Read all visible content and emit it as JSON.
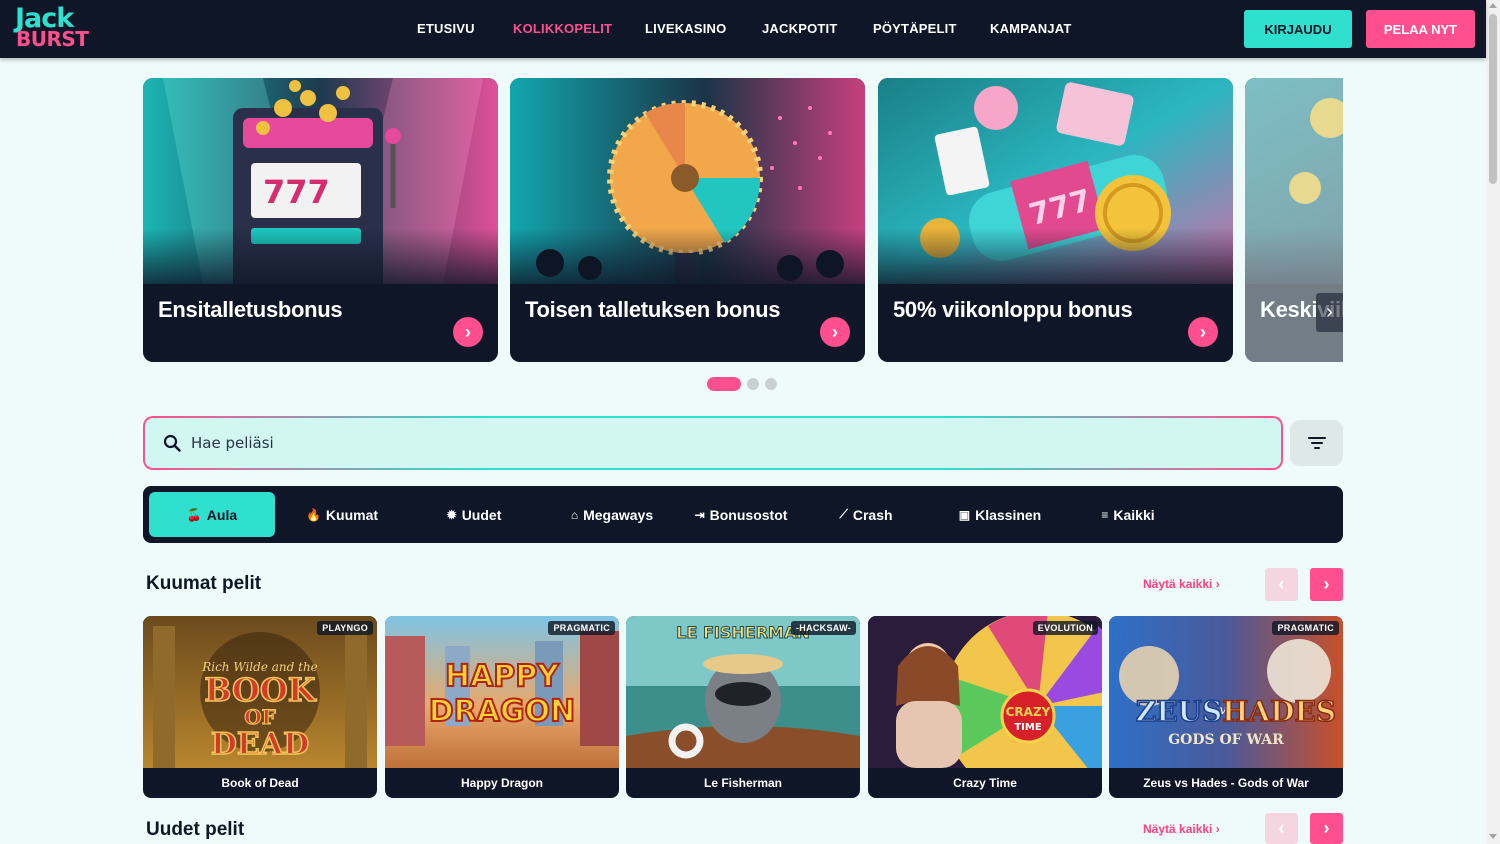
{
  "brand": {
    "logo_top": "Jack",
    "logo_bottom": "BURST"
  },
  "nav": {
    "items": [
      "ETUSIVU",
      "KOLIKKOPELIT",
      "LIVEKASINO",
      "JACKPOTIT",
      "PÖYTÄPELIT",
      "KAMPANJAT"
    ],
    "active": "KOLIKKOPELIT",
    "login_label": "KIRJAUDU",
    "play_label": "PELAA NYT"
  },
  "promos": [
    {
      "title": "Ensitalletusbonus",
      "icon": "chevron-right-icon"
    },
    {
      "title": "Toisen talletuksen bonus",
      "icon": "chevron-right-icon"
    },
    {
      "title": "50% viikonloppu bonus",
      "icon": "chevron-right-icon"
    },
    {
      "title": "Keskiviikon",
      "icon": "chevron-right-icon"
    }
  ],
  "carousel": {
    "pages": 3,
    "active_page": 1
  },
  "search": {
    "placeholder": "Hae peliäsi",
    "value": ""
  },
  "categories": [
    {
      "label": "Aula",
      "icon": "cherries-icon"
    },
    {
      "label": "Kuumat",
      "icon": "flame-icon"
    },
    {
      "label": "Uudet",
      "icon": "sparkle-icon"
    },
    {
      "label": "Megaways",
      "icon": "temple-icon"
    },
    {
      "label": "Bonusostot",
      "icon": "bonus-buy-icon"
    },
    {
      "label": "Crash",
      "icon": "trend-line-icon"
    },
    {
      "label": "Klassinen",
      "icon": "slot-machine-icon"
    },
    {
      "label": "Kaikki",
      "icon": "list-icon"
    }
  ],
  "sections": [
    {
      "title": "Kuumat pelit",
      "show_all": "Näytä kaikki",
      "games": [
        {
          "name": "Book of Dead",
          "provider": "PLAYNGO"
        },
        {
          "name": "Happy Dragon",
          "provider": "PRAGMATIC"
        },
        {
          "name": "Le Fisherman",
          "provider": "-HACKSAW-"
        },
        {
          "name": "Crazy Time",
          "provider": "EVOLUTION"
        },
        {
          "name": "Zeus vs Hades - Gods of War",
          "provider": "PRAGMATIC"
        }
      ]
    },
    {
      "title": "Uudet pelit",
      "show_all": "Näytä kaikki"
    }
  ],
  "thumb_text": {
    "bod_1": "Rich Wilde and the",
    "bod_2": "BOOK",
    "bod_3": "OF",
    "bod_4": "DEAD",
    "hd_1": "HAPPY",
    "hd_2": "DRAGON",
    "lf": "LE FISHERMAN",
    "ct_1": "CRAZY",
    "ct_2": "TIME",
    "zh_1": "ZEUS",
    "zh_2": "vs",
    "zh_3": "HADES",
    "zh_4": "GODS OF WAR"
  },
  "colors": {
    "navy": "#0e1627",
    "teal": "#2fe0cf",
    "pink": "#ff4f8e",
    "page_bg": "#effbfa"
  }
}
